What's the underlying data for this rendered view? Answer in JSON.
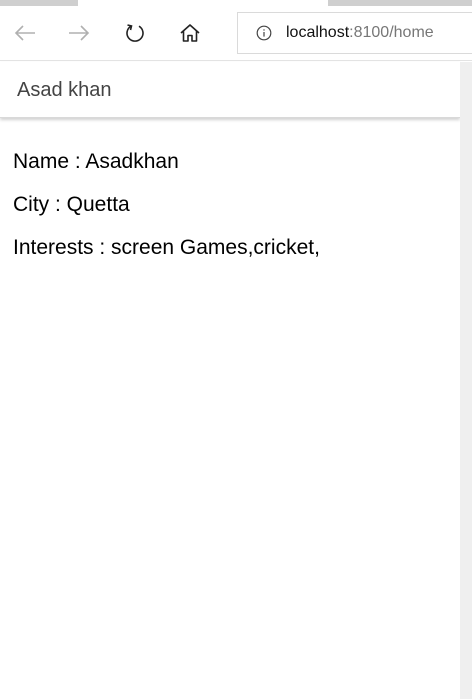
{
  "browser": {
    "url_host": "localhost",
    "url_rest": ":8100/home",
    "icons": {
      "back": "back-arrow-icon",
      "forward": "forward-arrow-icon",
      "refresh": "refresh-icon",
      "home": "home-icon",
      "info": "info-icon"
    }
  },
  "app": {
    "title": "Asad khan"
  },
  "profile": {
    "name_line": "Name : Asadkhan",
    "city_line": "City : Quetta",
    "interests_line": "Interests : screen Games,cricket,"
  },
  "colors": {
    "header_text": "#444444",
    "body_text": "#000000",
    "disabled_nav": "#b0b0b0",
    "active_nav": "#222222"
  }
}
